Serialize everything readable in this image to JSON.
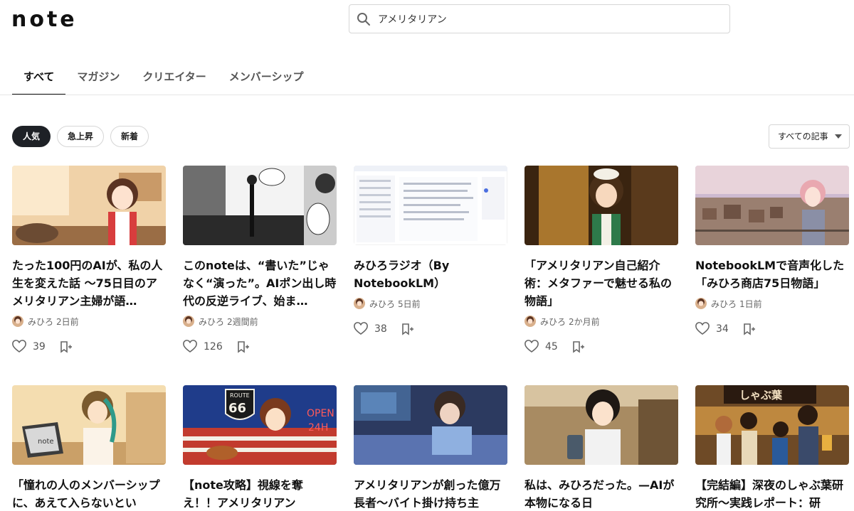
{
  "header": {
    "logo": "note",
    "search": {
      "value": "アメリタリアン",
      "icon": "search-icon"
    }
  },
  "tabs": [
    {
      "label": "すべて",
      "active": true
    },
    {
      "label": "マガジン",
      "active": false
    },
    {
      "label": "クリエイター",
      "active": false
    },
    {
      "label": "メンバーシップ",
      "active": false
    }
  ],
  "filters": [
    {
      "label": "人気",
      "active": true
    },
    {
      "label": "急上昇",
      "active": false
    },
    {
      "label": "新着",
      "active": false
    }
  ],
  "sort": {
    "label": "すべての記事"
  },
  "cards": [
    {
      "title": "たった100円のAIが、私の人生を変えた話 ～75日目のアメリタリアン主婦が語…",
      "author": "みひろ",
      "time": "2日前",
      "likes": "39",
      "thumb_colors": [
        "#f3d9b5",
        "#c9a27a"
      ]
    },
    {
      "title": "このnoteは、“書いた”じゃなく“演った”。AIポン出し時代の反逆ライブ、始ま…",
      "author": "みひろ",
      "time": "2週間前",
      "likes": "126",
      "thumb_colors": [
        "#e8e8e8",
        "#555555"
      ]
    },
    {
      "title": "みひろラジオ（By NotebookLM）",
      "author": "みひろ",
      "time": "5日前",
      "likes": "38",
      "thumb_colors": [
        "#ffffff",
        "#d9deea"
      ]
    },
    {
      "title": "「アメリタリアン自己紹介術：メタファーで魅せる私の物語」",
      "author": "みひろ",
      "time": "2か月前",
      "likes": "45",
      "thumb_colors": [
        "#7a4a1e",
        "#2f1e10"
      ]
    },
    {
      "title": "NotebookLMで音声化した「みひろ商店75日物語」",
      "author": "みひろ",
      "time": "1日前",
      "likes": "34",
      "thumb_colors": [
        "#c9b7c9",
        "#8e7b68"
      ]
    },
    {
      "title": "「憧れの人のメンバーシップに、あえて入らないとい",
      "author": "",
      "time": "",
      "likes": "",
      "thumb_colors": [
        "#f2d9a7",
        "#d8b073"
      ]
    },
    {
      "title": "【note攻略】視線を奪え！！アメリタリアン",
      "author": "",
      "time": "",
      "likes": "",
      "thumb_colors": [
        "#1f3c8a",
        "#c23b2e"
      ]
    },
    {
      "title": "アメリタリアンが創った億万長者～バイト掛け持ち主",
      "author": "",
      "time": "",
      "likes": "",
      "thumb_colors": [
        "#3d4e7a",
        "#1f2740"
      ]
    },
    {
      "title": "私は、みひろだった。—AIが本物になる日",
      "author": "",
      "time": "",
      "likes": "",
      "thumb_colors": [
        "#a88b62",
        "#5a4630"
      ]
    },
    {
      "title": "【完結編】深夜のしゃぶ葉研究所～実践レポート：研",
      "author": "",
      "time": "",
      "likes": "",
      "thumb_colors": [
        "#6e4a26",
        "#e0a24a"
      ]
    }
  ],
  "thumb_labels": {
    "card1": "",
    "card5_sign": "しゃぶ葉",
    "card6_laptop": "note",
    "card7_route": "ROUTE",
    "card7_66": "66",
    "card7_open": "OPEN",
    "card7_24h": "24H"
  }
}
